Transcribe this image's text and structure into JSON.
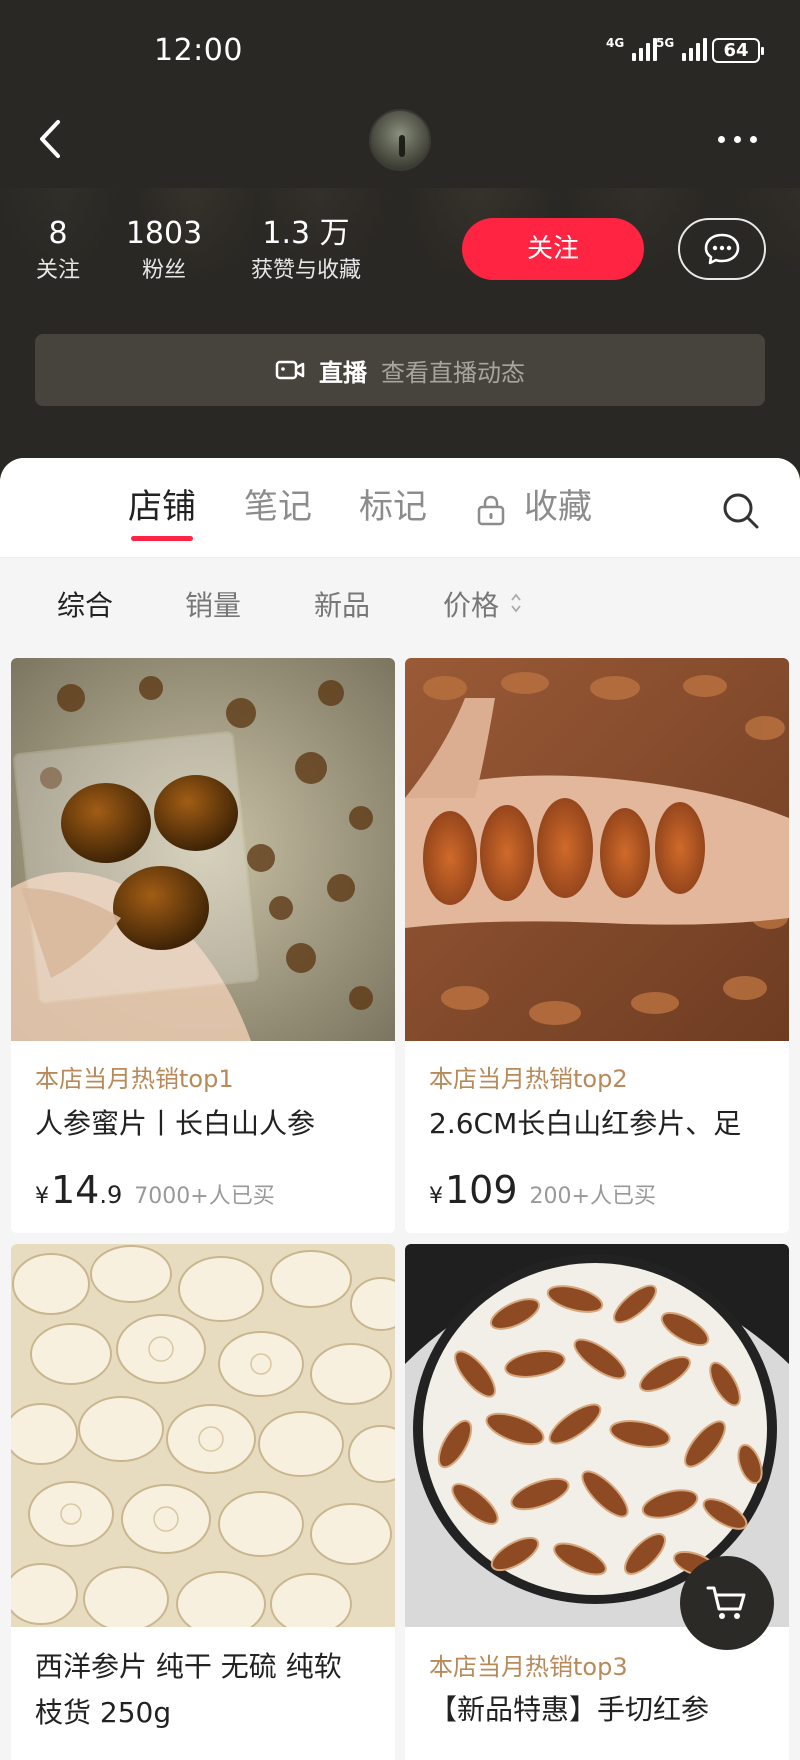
{
  "status": {
    "time": "12:00",
    "sim1": "4G",
    "sim2": "5G",
    "battery": "64"
  },
  "profile": {
    "stats": [
      {
        "value": "8",
        "label": "关注"
      },
      {
        "value": "1803",
        "label": "粉丝"
      },
      {
        "value": "1.3 万",
        "label": "获赞与收藏"
      }
    ],
    "follow_label": "关注",
    "live_label": "直播",
    "live_desc": "查看直播动态"
  },
  "tabs": [
    "店铺",
    "笔记",
    "标记",
    "收藏"
  ],
  "active_tab": "店铺",
  "filters": [
    "综合",
    "销量",
    "新品",
    "价格"
  ],
  "active_filter": "综合",
  "products": [
    {
      "tag": "本店当月热销top1",
      "title": "人参蜜片丨长白山人参",
      "yen": "¥",
      "price_int": "14",
      "price_dec": ".9",
      "sold": "7000+人已买"
    },
    {
      "tag": "本店当月热销top2",
      "title": "2.6CM长白山红参片、足",
      "yen": "¥",
      "price_int": "109",
      "price_dec": "",
      "sold": "200+人已买"
    },
    {
      "tag": "",
      "title_line1": "西洋参片 纯干 无硫 纯软",
      "title_line2": "枝货  250g"
    },
    {
      "tag": "本店当月热销top3",
      "title": "【新品特惠】手切红参"
    }
  ],
  "colors": {
    "accent": "#ff2442",
    "header_bg": "#2a2824",
    "tag": "#b88a5a"
  },
  "icons": [
    "back-arrow-icon",
    "more-icon",
    "message-icon",
    "video-camera-icon",
    "lock-icon",
    "search-icon",
    "sort-arrows-icon",
    "cart-icon"
  ]
}
